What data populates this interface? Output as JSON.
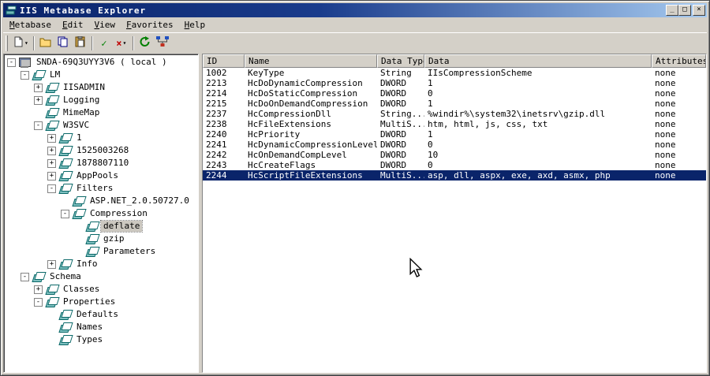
{
  "window": {
    "title": "IIS Metabase Explorer",
    "controls": {
      "minimize": "_",
      "maximize": "□",
      "close": "×"
    }
  },
  "menu": {
    "items": [
      {
        "label": "Metabase"
      },
      {
        "label": "Edit"
      },
      {
        "label": "View"
      },
      {
        "label": "Favorites"
      },
      {
        "label": "Help"
      }
    ]
  },
  "toolbar": {
    "buttons": [
      {
        "icon": "new-item-icon",
        "dropdown": true
      },
      {
        "icon": "open-icon"
      },
      {
        "icon": "copy-icon"
      },
      {
        "icon": "paste-icon"
      },
      {
        "icon": "apply-check-icon"
      },
      {
        "icon": "cancel-x-icon",
        "dropdown": true
      },
      {
        "icon": "refresh-icon"
      },
      {
        "icon": "connect-icon"
      }
    ],
    "dropdown_glyph": "▾",
    "check_glyph": "✓",
    "cancel_glyph": "×"
  },
  "tree": {
    "items": [
      {
        "label": "SNDA-69Q3UYY3V6 ( local )",
        "depth": 0,
        "expand": "-",
        "icon": "computer"
      },
      {
        "label": "LM",
        "depth": 1,
        "expand": "-",
        "icon": "metabase"
      },
      {
        "label": "IISADMIN",
        "depth": 2,
        "expand": "+",
        "icon": "metabase"
      },
      {
        "label": "Logging",
        "depth": 2,
        "expand": "+",
        "icon": "metabase"
      },
      {
        "label": "MimeMap",
        "depth": 2,
        "expand": "",
        "icon": "metabase"
      },
      {
        "label": "W3SVC",
        "depth": 2,
        "expand": "-",
        "icon": "metabase"
      },
      {
        "label": "1",
        "depth": 3,
        "expand": "+",
        "icon": "metabase"
      },
      {
        "label": "1525003268",
        "depth": 3,
        "expand": "+",
        "icon": "metabase"
      },
      {
        "label": "1878807110",
        "depth": 3,
        "expand": "+",
        "icon": "metabase"
      },
      {
        "label": "AppPools",
        "depth": 3,
        "expand": "+",
        "icon": "metabase"
      },
      {
        "label": "Filters",
        "depth": 3,
        "expand": "-",
        "icon": "metabase"
      },
      {
        "label": "ASP.NET_2.0.50727.0",
        "depth": 4,
        "expand": "",
        "icon": "metabase"
      },
      {
        "label": "Compression",
        "depth": 4,
        "expand": "-",
        "icon": "metabase"
      },
      {
        "label": "deflate",
        "depth": 5,
        "expand": "",
        "icon": "metabase",
        "selected": true
      },
      {
        "label": "gzip",
        "depth": 5,
        "expand": "",
        "icon": "metabase"
      },
      {
        "label": "Parameters",
        "depth": 5,
        "expand": "",
        "icon": "metabase"
      },
      {
        "label": "Info",
        "depth": 3,
        "expand": "+",
        "icon": "metabase"
      },
      {
        "label": "Schema",
        "depth": 1,
        "expand": "-",
        "icon": "metabase"
      },
      {
        "label": "Classes",
        "depth": 2,
        "expand": "+",
        "icon": "metabase"
      },
      {
        "label": "Properties",
        "depth": 2,
        "expand": "-",
        "icon": "metabase"
      },
      {
        "label": "Defaults",
        "depth": 3,
        "expand": "",
        "icon": "metabase"
      },
      {
        "label": "Names",
        "depth": 3,
        "expand": "",
        "icon": "metabase"
      },
      {
        "label": "Types",
        "depth": 3,
        "expand": "",
        "icon": "metabase"
      }
    ]
  },
  "table": {
    "columns": [
      "ID",
      "Name",
      "Data Type",
      "Data",
      "Attributes"
    ],
    "rows": [
      [
        "1002",
        "KeyType",
        "String",
        "IIsCompressionScheme",
        "none"
      ],
      [
        "2213",
        "HcDoDynamicCompression",
        "DWORD",
        "1",
        "none"
      ],
      [
        "2214",
        "HcDoStaticCompression",
        "DWORD",
        "0",
        "none"
      ],
      [
        "2215",
        "HcDoOnDemandCompression",
        "DWORD",
        "1",
        "none"
      ],
      [
        "2237",
        "HcCompressionDll",
        "String...",
        "%windir%\\system32\\inetsrv\\gzip.dll",
        "none"
      ],
      [
        "2238",
        "HcFileExtensions",
        "MultiS...",
        "htm, html, js, css, txt",
        "none"
      ],
      [
        "2240",
        "HcPriority",
        "DWORD",
        "1",
        "none"
      ],
      [
        "2241",
        "HcDynamicCompressionLevel",
        "DWORD",
        "0",
        "none"
      ],
      [
        "2242",
        "HcOnDemandCompLevel",
        "DWORD",
        "10",
        "none"
      ],
      [
        "2243",
        "HcCreateFlags",
        "DWORD",
        "0",
        "none"
      ],
      [
        "2244",
        "HcScriptFileExtensions",
        "MultiS...",
        "asp, dll, aspx, exe, axd, asmx, php",
        "none"
      ]
    ],
    "selected_row_id": "2244"
  },
  "colors": {
    "titlebar_start": "#0a246a",
    "titlebar_end": "#a6caf0",
    "chrome": "#d4d0c8",
    "selection": "#0a246a",
    "panel_bg": "#ffffff"
  }
}
